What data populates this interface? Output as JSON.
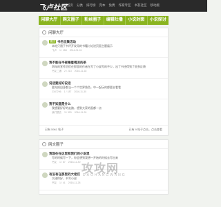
{
  "header": {
    "logo": "飞卢社区",
    "nav": [
      "书城首页",
      "分类",
      "排行榜",
      "完本",
      "免费",
      "作家专区",
      "书友社区",
      "移动版"
    ]
  },
  "tabs": [
    "闲聊大厅",
    "网文圈子",
    "粉丝圈子",
    "编辑社播",
    "小说封面",
    "小说探讨"
  ],
  "lobby": {
    "title": "闲聊大厅",
    "posts": [
      {
        "badge": "置顶",
        "title": "书名征集活动",
        "body": "本帖只限于书评开发用的书籍讨论进页面主题展示",
        "meta": [
          "飞卢",
          "1 / 158",
          "2014-01-01"
        ]
      },
      {
        "badge": "",
        "title": "我不能在半夜睡着喝凉的茶",
        "body": "四年的宣传员们在那里的作者在写了小说写的不少，出了书还得到了很多反馈",
        "meta": [
          "书友二通",
          "2 / 213",
          "2016-11-18"
        ]
      },
      {
        "badge": "",
        "title": "说话要好好说话",
        "body": "要先把自身都当一个个世界角色，中一起玩的都要去看看",
        "meta": [
          "2347296",
          "1 / 187",
          "2016-11-30"
        ]
      },
      {
        "badge": "",
        "title": "我不知道是什么",
        "body": "我想要好好的走路，想到大家的面都一点",
        "meta": [
          "我们想去",
          "3 / 320",
          "2016-11-20"
        ]
      }
    ],
    "footer": [
      "已有 5961 帖子",
      "已有 9 帖子点击，点击查看"
    ]
  },
  "fiction": {
    "title": "网文圈子",
    "posts": [
      {
        "badge": "",
        "title": "我现在在这里和我们的小说里",
        "body": "写的时候写一下，你会想到我想一开始的时候去写出来",
        "meta": [
          "书友",
          "1 / 67",
          "2016-11-30"
        ]
      },
      {
        "badge": "",
        "title": "有没有在那里的大佬们",
        "body": "大佬你好，书写小说",
        "meta": [
          "书友",
          "1 / 41",
          "2016-11-28"
        ]
      }
    ]
  },
  "watermark": {
    "main": "攻攻网",
    "sub": "DAOHANGWANG"
  }
}
